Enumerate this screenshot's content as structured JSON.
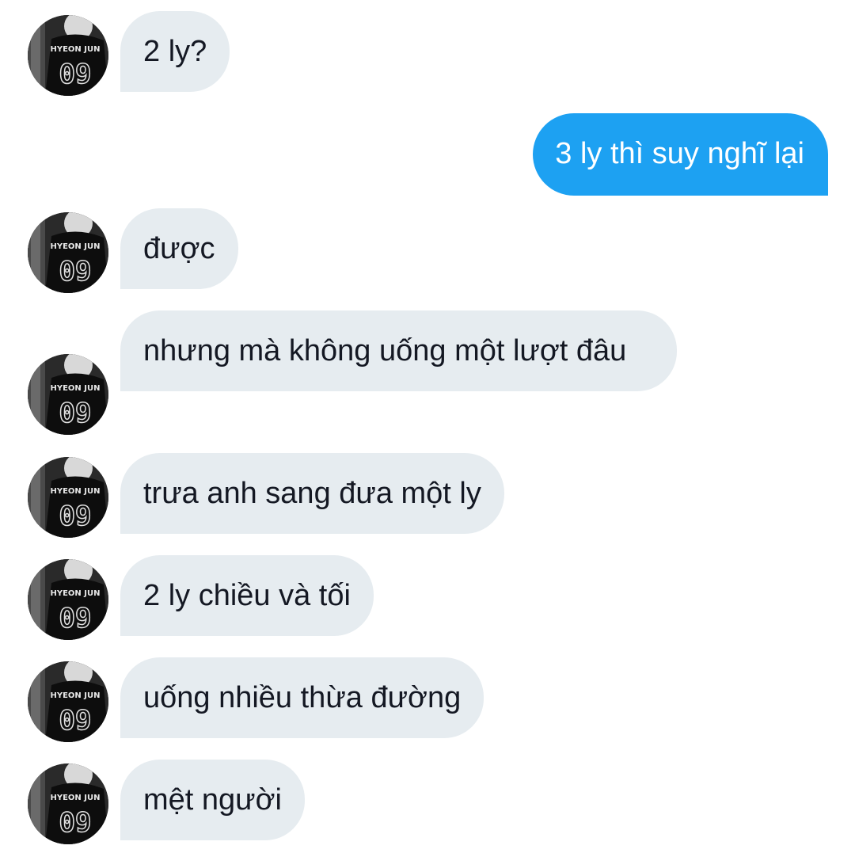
{
  "conversation": {
    "messages": [
      {
        "sender": "them",
        "text": "2 ly?"
      },
      {
        "sender": "me",
        "text": "3 ly thì suy nghĩ lại"
      },
      {
        "sender": "them",
        "text": "được"
      },
      {
        "sender": "them",
        "text": "nhưng mà không uống một lượt đâu"
      },
      {
        "sender": "them",
        "text": "trưa anh sang đưa một ly"
      },
      {
        "sender": "them",
        "text": "2 ly chiều và tối"
      },
      {
        "sender": "them",
        "text": "uống nhiều thừa đường"
      },
      {
        "sender": "them",
        "text": "mệt người"
      }
    ]
  },
  "avatar": {
    "jersey_name": "HYEON JUN",
    "jersey_number": "09",
    "style": "black-and-white photo"
  },
  "colors": {
    "incoming_bubble": "#e6ecf0",
    "outgoing_bubble": "#1da1f2",
    "incoming_text": "#141823",
    "outgoing_text": "#ffffff",
    "background": "#ffffff"
  }
}
